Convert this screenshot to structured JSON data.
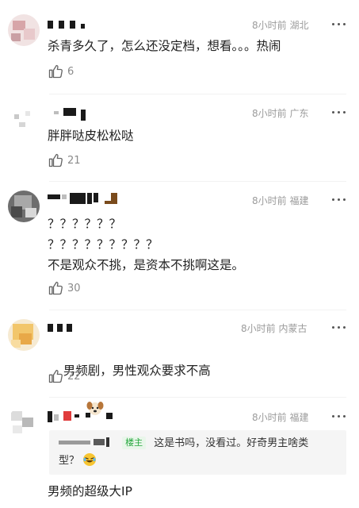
{
  "comments": [
    {
      "time": "8小时前",
      "location": "湖北",
      "text": "杀青多久了，怎么还没定档，想看。。。热闹",
      "likes": "6"
    },
    {
      "time": "8小时前",
      "location": "广东",
      "text": "胖胖哒皮松松哒",
      "likes": "21"
    },
    {
      "time": "8小时前",
      "location": "福建",
      "text": "？？？？？？\n？？？？？？？？？\n不是观众不挑，是资本不挑啊这是。",
      "likes": "30"
    },
    {
      "time": "8小时前",
      "location": "内蒙古",
      "text": "男频剧，男性观众要求不高",
      "likes": "22"
    },
    {
      "time": "8小时前",
      "location": "福建",
      "reply_tag": "楼主",
      "reply_text_line1": "这是书吗，没看过。好奇男主啥类",
      "reply_text_line2": "型？",
      "text": "男频的超级大IP"
    }
  ],
  "icons": {
    "like": "thumbs-up-icon",
    "more": "more-dots-icon",
    "dog": "dog-emoji-icon",
    "laugh": "laughing-emoji-icon"
  },
  "colors": {
    "meta": "#9b9b9b",
    "tag_bg": "#e9f6ea",
    "tag_text": "#22a63a"
  }
}
